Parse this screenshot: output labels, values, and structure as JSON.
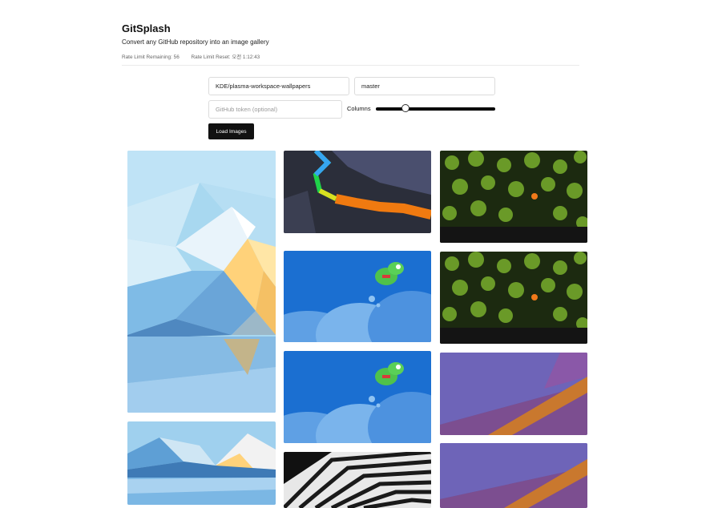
{
  "app": {
    "title": "GitSplash",
    "subtitle": "Convert any GitHub repository into an image gallery",
    "rate_remaining": "Rate Limit Remaining: 56",
    "rate_reset": "Rate Limit Reset: 오전 1:12:43"
  },
  "form": {
    "repo_value": "KDE/plasma-workspace-wallpapers",
    "branch_value": "master",
    "token_placeholder": "GitHub token (optional)",
    "columns_label": "Columns",
    "columns_value": 0.23,
    "load_button": "Load Images"
  },
  "gallery": {
    "images": [
      {
        "subject": "blue polygon mountain lake wallpaper (tall)"
      },
      {
        "subject": "hexagon path wallpaper"
      },
      {
        "subject": "green spiky plants wallpaper"
      },
      {
        "subject": "blue cartoon dragon bubbles wallpaper"
      },
      {
        "subject": "green spiky plants wallpaper"
      },
      {
        "subject": "blue cartoon dragon bubbles wallpaper"
      },
      {
        "subject": "purple orange geometric wallpaper"
      },
      {
        "subject": "polygon mountain lake wallpaper"
      },
      {
        "subject": "black white lattice wallpaper"
      },
      {
        "subject": "purple orange geometric wallpaper"
      }
    ]
  }
}
